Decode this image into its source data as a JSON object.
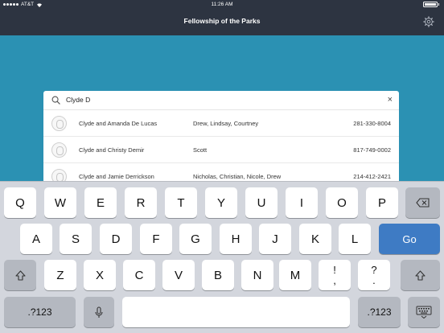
{
  "status_bar": {
    "carrier": "AT&T",
    "time": "11:26 AM",
    "icons": [
      "signal-dots-icon",
      "wifi-icon",
      "battery-icon"
    ]
  },
  "nav": {
    "title": "Fellowship of the Parks",
    "settings_icon": "gear-icon"
  },
  "search": {
    "value": "Clyde D",
    "icon": "search-icon",
    "clear": "×"
  },
  "results": [
    {
      "name": "Clyde and Amanda De Lucas",
      "children": "Drew, Lindsay, Courtney",
      "phone": "281-330-8004"
    },
    {
      "name": "Clyde and Christy Demir",
      "children": "Scott",
      "phone": "817-749-0002"
    },
    {
      "name": "Clyde and Jamie Derrickson",
      "children": "Nicholas, Christian, Nicole, Drew",
      "phone": "214-412-2421"
    }
  ],
  "keyboard": {
    "row1": [
      "Q",
      "W",
      "E",
      "R",
      "T",
      "Y",
      "U",
      "I",
      "O",
      "P"
    ],
    "row2": [
      "A",
      "S",
      "D",
      "F",
      "G",
      "H",
      "J",
      "K",
      "L"
    ],
    "row3": [
      "Z",
      "X",
      "C",
      "V",
      "B",
      "N",
      "M"
    ],
    "go_label": "Go",
    "numbers_label": ".?123",
    "punct1": [
      "!",
      ","
    ],
    "punct2": [
      "?",
      "."
    ]
  },
  "colors": {
    "background": "#2b91b3",
    "nav": "#2d3441",
    "go_key": "#3e7bc4"
  }
}
